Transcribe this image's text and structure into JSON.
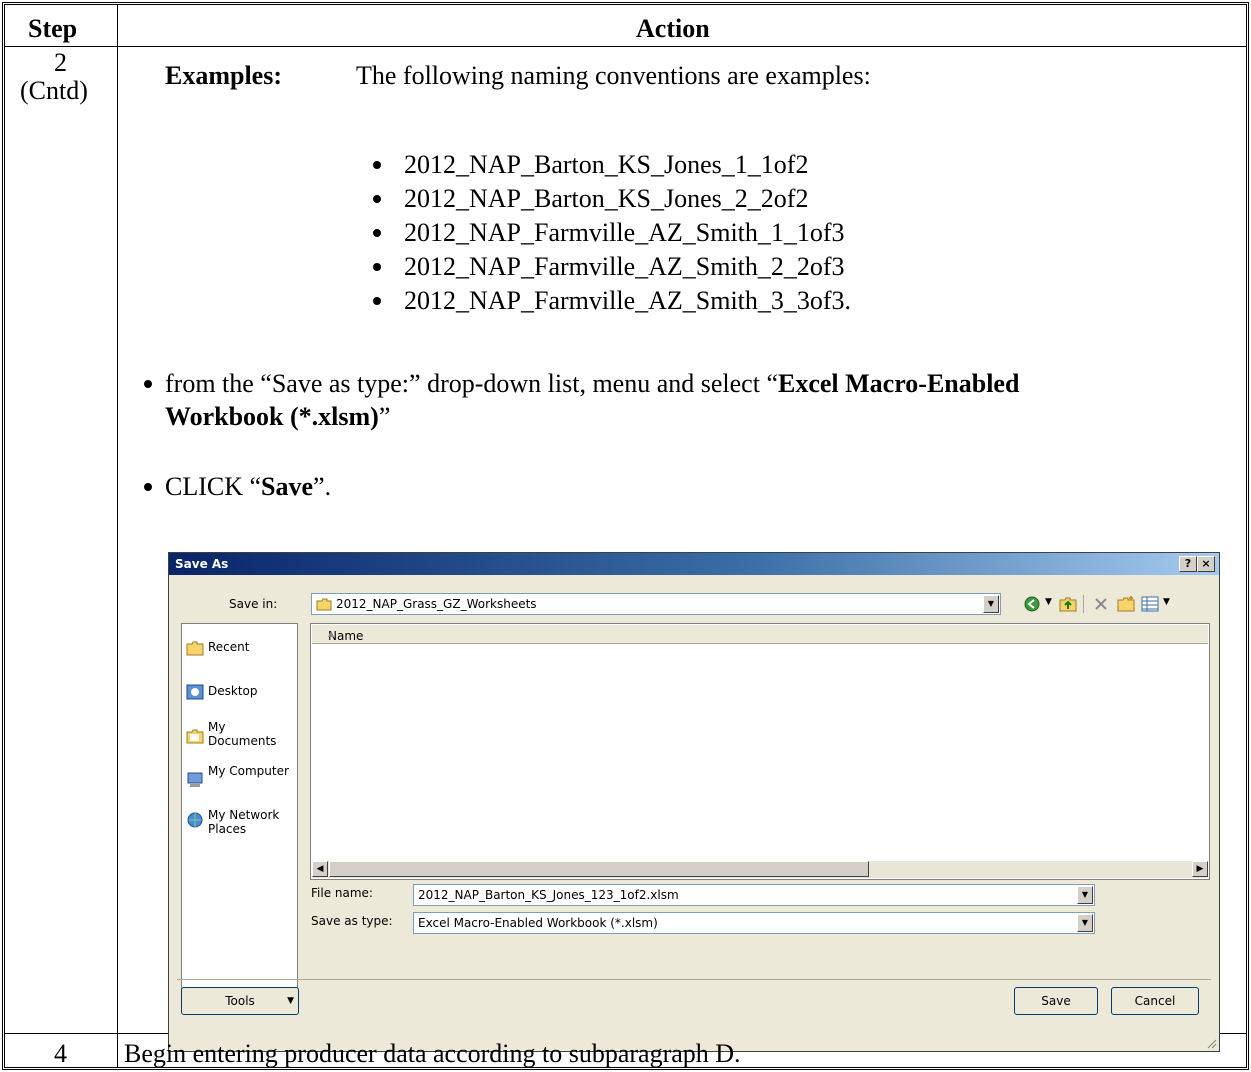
{
  "table": {
    "header": {
      "step": "Step",
      "action": "Action"
    },
    "row1": {
      "step": "2",
      "step_note": "(Cntd)",
      "examples_label": "Examples:",
      "examples_intro": "The following naming conventions are examples:",
      "examples": [
        "2012_NAP_Barton_KS_Jones_1_1of2",
        "2012_NAP_Barton_KS_Jones_2_2of2",
        "2012_NAP_Farmville_AZ_Smith_1_1of3",
        "2012_NAP_Farmville_AZ_Smith_2_2of3",
        "2012_NAP_Farmville_AZ_Smith_3_3of3."
      ],
      "bullet1": {
        "pre": "from the “Save as type:” drop-down list, menu and select “",
        "bold": "Excel Macro-Enabled",
        "bold2": "Workbook (*.xlsm)",
        "post": "”"
      },
      "bullet2": {
        "pre": "CLICK “",
        "bold": "Save",
        "post": "”."
      }
    },
    "row2": {
      "step": "4",
      "action": "Begin entering producer data according to subparagraph D."
    }
  },
  "dialog": {
    "title": "Save As",
    "help_btn": "?",
    "close_btn": "×",
    "save_in_label": "Save in:",
    "save_in_value": "2012_NAP_Grass_GZ_Worksheets",
    "places": [
      "Recent",
      "Desktop",
      "My Documents",
      "My Computer",
      "My Network Places"
    ],
    "column_name": "Name",
    "file_name_label": "File name:",
    "file_name_value": "2012_NAP_Barton_KS_Jones_123_1of2.xlsm",
    "save_as_type_label": "Save as type:",
    "save_as_type_value": "Excel Macro-Enabled Workbook (*.xlsm)",
    "tools_label": "Tools",
    "save_label": "Save",
    "cancel_label": "Cancel"
  }
}
